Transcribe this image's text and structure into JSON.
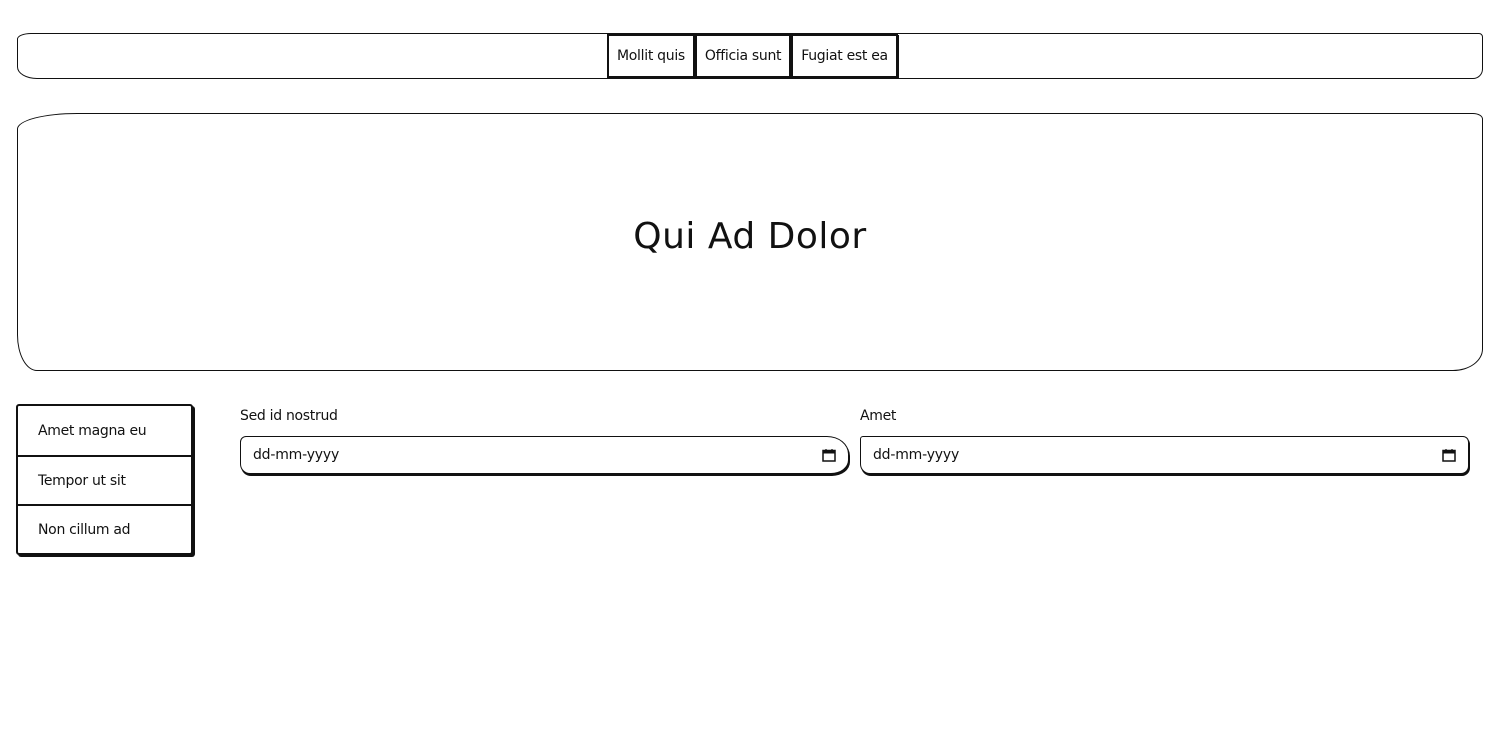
{
  "nav": {
    "items": [
      {
        "label": "Mollit quis"
      },
      {
        "label": "Officia sunt"
      },
      {
        "label": "Fugiat est ea"
      }
    ]
  },
  "hero": {
    "title": "Qui Ad Dolor"
  },
  "side_menu": {
    "items": [
      {
        "label": "Amet magna eu"
      },
      {
        "label": "Tempor ut sit"
      },
      {
        "label": "Non cillum ad"
      }
    ]
  },
  "form": {
    "fields": [
      {
        "label": "Sed id nostrud",
        "placeholder": "dd-mm-yyyy",
        "icon": "calendar-icon"
      },
      {
        "label": "Amet",
        "placeholder": "dd-mm-yyyy",
        "icon": "calendar-icon"
      }
    ]
  }
}
